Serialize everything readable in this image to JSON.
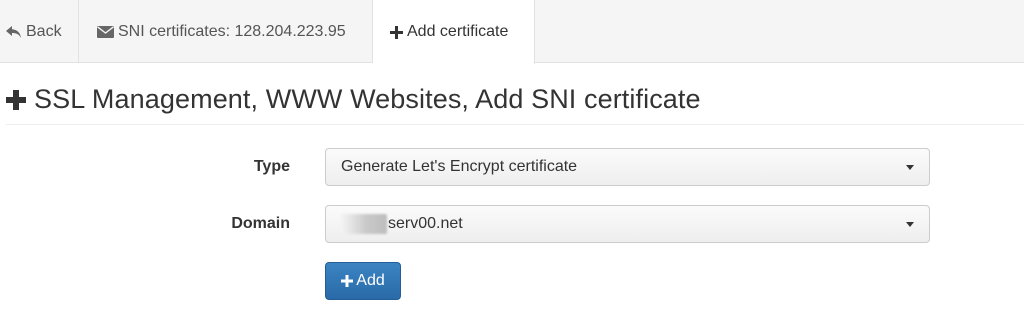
{
  "tabs": {
    "back": {
      "label": "Back",
      "icon": "reply-arrow-icon"
    },
    "sni": {
      "label": "SNI certificates: 128.204.223.95",
      "icon": "envelope-icon"
    },
    "add": {
      "label": "Add certificate",
      "icon": "plus-icon"
    }
  },
  "page": {
    "title": "SSL Management, WWW Websites, Add SNI certificate"
  },
  "form": {
    "type": {
      "label": "Type",
      "selected": "Generate Let's Encrypt certificate"
    },
    "domain": {
      "label": "Domain",
      "selected": "serv00.net"
    },
    "submit_label": "Add"
  },
  "colors": {
    "primary_button": "#2f74b5",
    "tab_bar": "#f5f5f5",
    "text": "#333333"
  }
}
